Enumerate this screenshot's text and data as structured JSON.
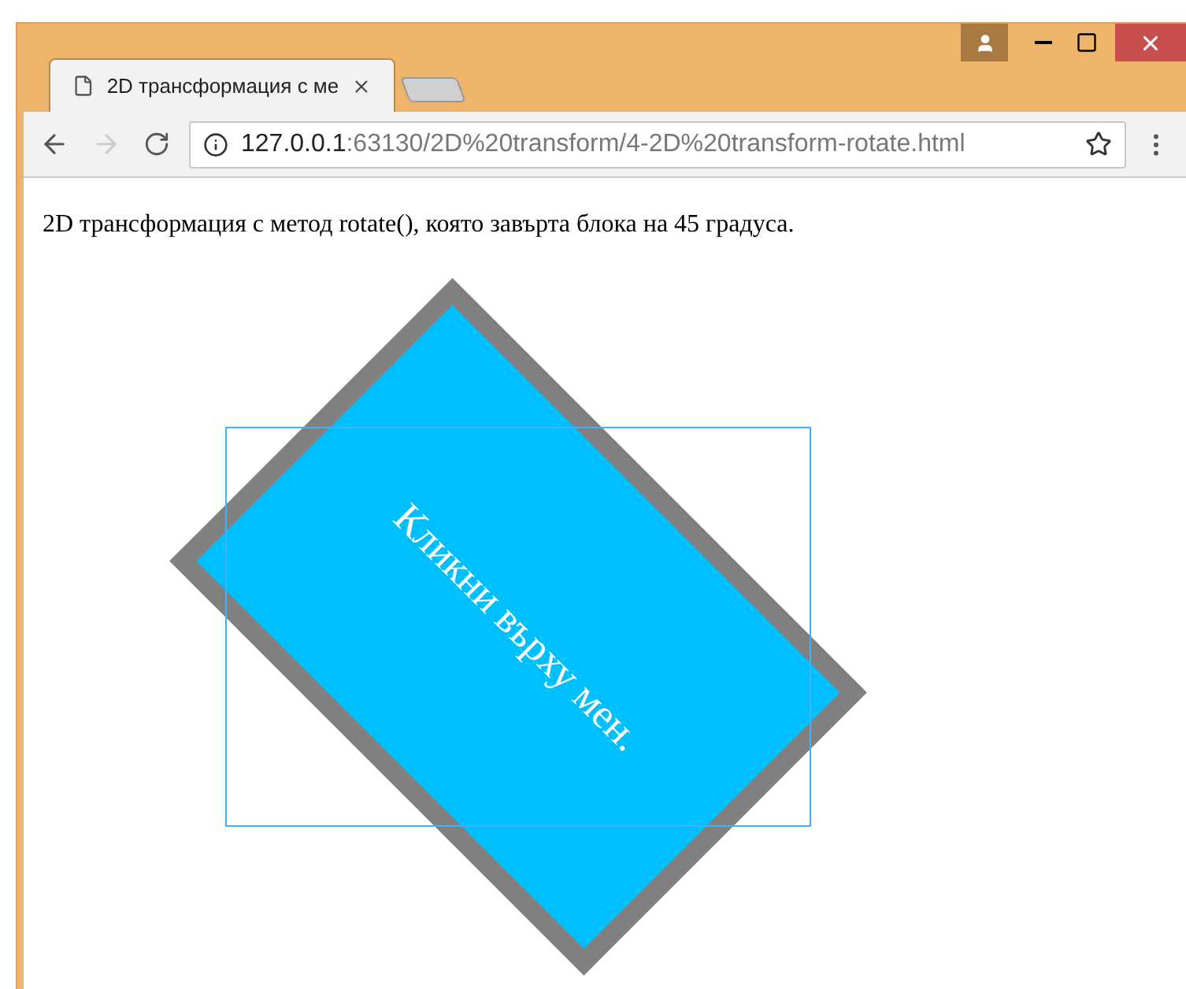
{
  "tabs": [
    {
      "title": "2D трансформация с ме",
      "selected": true
    }
  ],
  "address_bar": {
    "host": "127.0.0.1",
    "path": ":63130/2D%20transform/4-2D%20transform-rotate.html"
  },
  "page": {
    "paragraph": "2D трансформация с метод rotate(), която завърта блока на 45 градуса.",
    "box_text": "Кликни върху мен.",
    "outline_shown": true
  }
}
